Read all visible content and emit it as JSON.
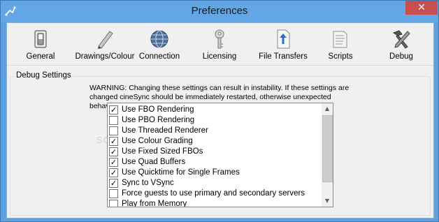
{
  "window": {
    "title": "Preferences",
    "close_glyph": "✕"
  },
  "toolbar": {
    "items": [
      {
        "label": "General",
        "icon": "switch-icon"
      },
      {
        "label": "Drawings/Colour",
        "icon": "pencil-icon"
      },
      {
        "label": "Connection",
        "icon": "globe-icon"
      },
      {
        "label": "Licensing",
        "icon": "key-icon"
      },
      {
        "label": "File Transfers",
        "icon": "file-upload-icon"
      },
      {
        "label": "Scripts",
        "icon": "scripts-icon"
      },
      {
        "label": "Debug",
        "icon": "tools-icon"
      }
    ]
  },
  "debug": {
    "group_label": "Debug Settings",
    "warning": "WARNING: Changing these settings can result in instability. If these settings are changed cineSync should be immediately restarted, otherwise unexpected behavior may occur.",
    "check_glyph": "✓",
    "options": [
      {
        "label": "Use FBO Rendering",
        "checked": true
      },
      {
        "label": "Use PBO Rendering",
        "checked": false
      },
      {
        "label": "Use Threaded Renderer",
        "checked": false
      },
      {
        "label": "Use Colour Grading",
        "checked": true
      },
      {
        "label": "Use Fixed Sized FBOs",
        "checked": true
      },
      {
        "label": "Use Quad Buffers",
        "checked": true
      },
      {
        "label": "Use Quicktime for Single Frames",
        "checked": true
      },
      {
        "label": "Sync to VSync",
        "checked": true
      },
      {
        "label": "Force guests to use primary and secondary servers",
        "checked": false
      },
      {
        "label": "Play from Memory",
        "checked": false
      }
    ]
  },
  "scrollbar": {
    "up_glyph": "▲",
    "down_glyph": "▼"
  },
  "watermark": "SOFT"
}
